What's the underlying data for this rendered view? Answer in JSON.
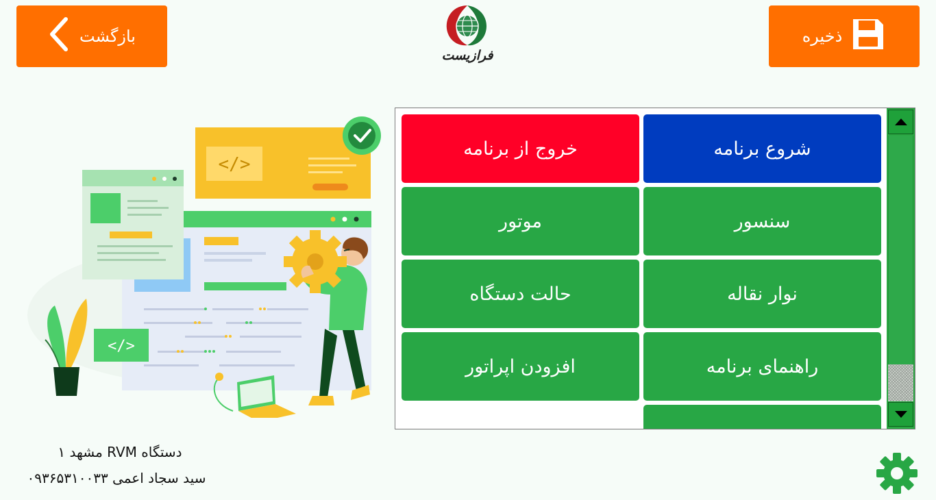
{
  "header": {
    "save_label": "ذخیره",
    "back_label": "بازگشت",
    "logo_text": "فرازیست"
  },
  "colors": {
    "accent_orange": "#ff6f00",
    "start_blue": "#003cbf",
    "exit_red": "#ff0027",
    "menu_green": "#28a745",
    "background": "#f6fcf8"
  },
  "menu": {
    "items": [
      {
        "label": "شروع برنامه",
        "color": "#003cbf"
      },
      {
        "label": "خروج از برنامه",
        "color": "#ff0027"
      },
      {
        "label": "سنسور",
        "color": "#28a745"
      },
      {
        "label": "موتور",
        "color": "#28a745"
      },
      {
        "label": "نوار نقاله",
        "color": "#28a745"
      },
      {
        "label": "حالت دستگاه",
        "color": "#28a745"
      },
      {
        "label": "راهنمای برنامه",
        "color": "#28a745"
      },
      {
        "label": "افزودن اپراتور",
        "color": "#28a745"
      },
      {
        "label": "",
        "color": "#28a745"
      }
    ]
  },
  "footer": {
    "device_name": "دستگاه RVM مشهد ۱",
    "operator": "سید سجاد اعمی ۰۹۳۶۵۳۱۰۰۳۳"
  },
  "icons": {
    "save": "floppy-disk-icon",
    "back": "chevron-left-icon",
    "settings": "gear-icon",
    "scroll_up": "triangle-up-icon",
    "scroll_down": "triangle-down-icon"
  }
}
